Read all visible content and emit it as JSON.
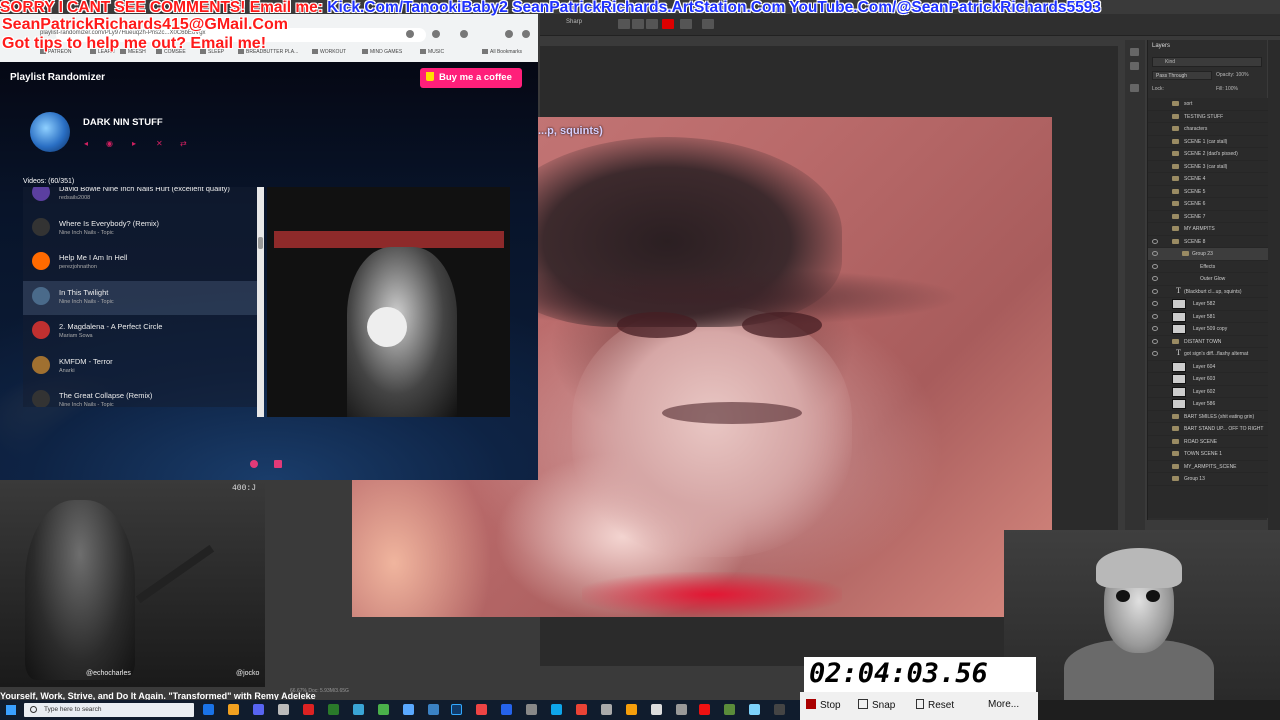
{
  "banner": {
    "sorry": "SORRY I CANT SEE COMMENTS! Email me: ",
    "kick": "Kick.Com/TanookiBaby2",
    "artstation": "SeanPatrickRichards.ArtStation.Com",
    "youtube": "YouTube.Com/@SeanPatrickRichards5593",
    "email": "SeanPatrickRichards415@GMail.Com",
    "tips": "Got tips to help me out? Email me!"
  },
  "browser": {
    "url": "playlist-randomizer.com/PLy97Hueuq2h-Pns2c...X0C6bEoVgx",
    "bookmarks": [
      "PATREON",
      "LEARN",
      "MEESH",
      "COMSEE",
      "SLEEP",
      "BREADBUTTER PLA...",
      "WORKOUT",
      "MIND GAMES",
      "MUSIC",
      "All Bookmarks"
    ]
  },
  "app": {
    "title": "Playlist Randomizer",
    "coffee": "Buy me a coffee",
    "playlist_name": "DARK NIN STUFF",
    "videos_count": "Videos: (60/351)",
    "items": [
      {
        "title": "David Bowie Nine Inch Nails Hurt (excellent quality)",
        "artist": "redsails2008"
      },
      {
        "title": "Where Is Everybody? (Remix)",
        "artist": "Nine Inch Nails - Topic"
      },
      {
        "title": "Help Me I Am In Hell",
        "artist": "perezjohnathon"
      },
      {
        "title": "In This Twilight",
        "artist": "Nine Inch Nails - Topic"
      },
      {
        "title": "2. Magdalena - A Perfect Circle",
        "artist": "Mariam Sowa"
      },
      {
        "title": "KMFDM - Terror",
        "artist": "Anarki"
      },
      {
        "title": "The Great Collapse (Remix)",
        "artist": "Nine Inch Nails - Topic"
      }
    ]
  },
  "photoshop": {
    "sharp": "Sharp",
    "caption": "...p, squints)",
    "layers_tab": "Layers",
    "filter": "Kind",
    "blend": "Pass Through",
    "opacity": "Opacity: 100%",
    "lock": "Lock:",
    "fill": "Fill: 100%",
    "layers": [
      "sort",
      "TESTING STUFF",
      "characters",
      "SCENE 1 (car stall)",
      "SCENE 2 (dad's pissed)",
      "SCENE 3 (car stall)",
      "SCENE 4",
      "SCENE 5",
      "SCENE 6",
      "SCENE 7",
      "MY ARMPITS",
      "SCENE 8",
      "Group 23",
      "Effects",
      "Outer Glow",
      "(Blackburt cl...up, squints)",
      "Layer 582",
      "Layer 581",
      "Layer 509 copy",
      "DISTANT TOWN",
      "got sign's diff...flashy alternat",
      "Layer 604",
      "Layer 603",
      "Layer 602",
      "Layer 586",
      "BART SMILES (shit eating grin)",
      "BART STAND UP... OFF TO RIGHT",
      "ROAD SCENE",
      "TOWN SCENE 1",
      "MY_ARMPITS_SCENE",
      "Group 13"
    ],
    "status": "66.67%    Doc: 5.93M/3.65G"
  },
  "webcam": {
    "handle_left": "@echocharles",
    "handle_right": "@jocko",
    "timestamp": "400:J"
  },
  "stopwatch": {
    "time": "02:04:03.56",
    "stop": "Stop",
    "snap": "Snap",
    "reset": "Reset",
    "more": "More..."
  },
  "caption": "Yourself, Work, Strive, and Do It Again. \"Transformed\" with Remy Adeleke",
  "taskbar": {
    "search_placeholder": "Type here to search"
  }
}
